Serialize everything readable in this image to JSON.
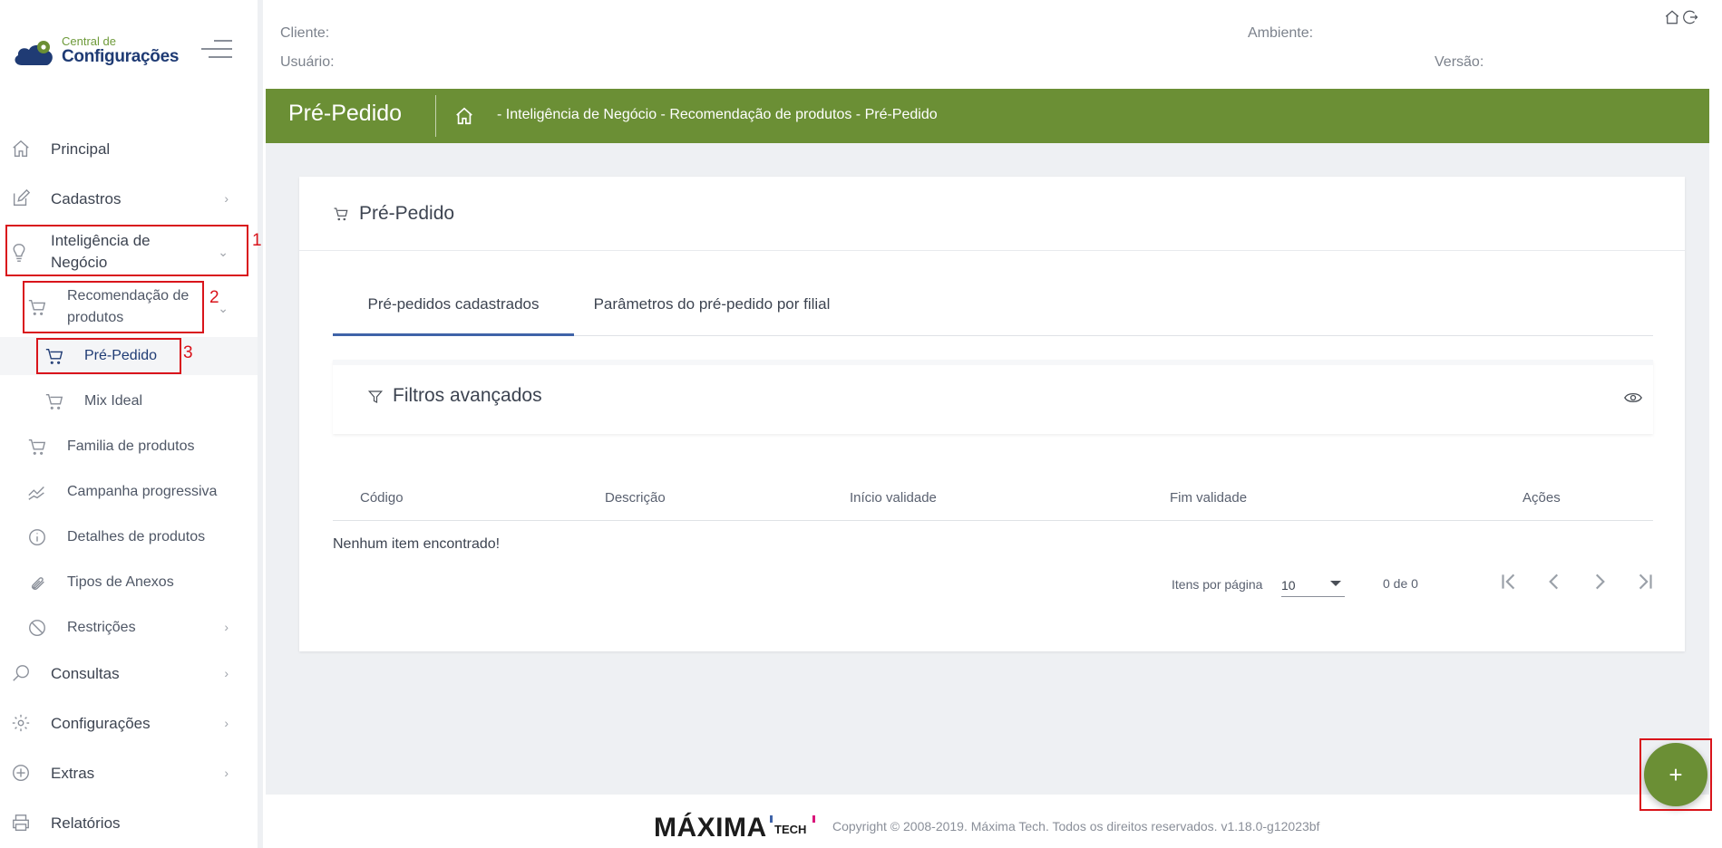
{
  "app": {
    "logo_line1": "Central de",
    "logo_line2": "Configurações"
  },
  "header": {
    "cliente_label": "Cliente:",
    "usuario_label": "Usuário:",
    "ambiente_label": "Ambiente:",
    "versao_label": "Versão:"
  },
  "sidebar": {
    "items": [
      {
        "label": "Principal",
        "icon": "home-icon"
      },
      {
        "label": "Cadastros",
        "icon": "edit-icon"
      },
      {
        "label": "Inteligência de Negócio",
        "icon": "lightbulb-icon"
      },
      {
        "label": "Recomendação de produtos",
        "icon": "cart-icon"
      },
      {
        "label": "Pré-Pedido",
        "icon": "cart-icon"
      },
      {
        "label": "Mix Ideal",
        "icon": "cart-icon"
      },
      {
        "label": "Familia de produtos",
        "icon": "cart-icon"
      },
      {
        "label": "Campanha progressiva",
        "icon": "trend-icon"
      },
      {
        "label": "Detalhes de produtos",
        "icon": "info-icon"
      },
      {
        "label": "Tipos de Anexos",
        "icon": "paperclip-icon"
      },
      {
        "label": "Restrições",
        "icon": "block-icon"
      },
      {
        "label": "Consultas",
        "icon": "search-icon"
      },
      {
        "label": "Configurações",
        "icon": "gear-icon"
      },
      {
        "label": "Extras",
        "icon": "plus-circle-icon"
      },
      {
        "label": "Relatórios",
        "icon": "printer-icon"
      }
    ],
    "markers": [
      "1",
      "2",
      "3"
    ]
  },
  "page": {
    "title": "Pré-Pedido",
    "breadcrumb": "- Inteligência de Negócio - Recomendação de produtos - Pré-Pedido"
  },
  "card": {
    "title": "Pré-Pedido",
    "tabs": [
      {
        "label": "Pré-pedidos cadastrados",
        "active": true
      },
      {
        "label": "Parâmetros do pré-pedido por filial",
        "active": false
      }
    ],
    "filters_title": "Filtros avançados",
    "table": {
      "columns": [
        "Código",
        "Descrição",
        "Início validade",
        "Fim validade",
        "Ações"
      ],
      "empty_message": "Nenhum item encontrado!"
    },
    "paginator": {
      "per_page_label": "Itens por página",
      "per_page_value": "10",
      "range_label": "0 de 0"
    }
  },
  "footer": {
    "brand": "MÁXIMA",
    "brand_suffix": "TECH",
    "copyright": "Copyright © 2008-2019. Máxima Tech. Todos os direitos reservados. v1.18.0-g12023bf"
  },
  "fab": {
    "label": "+"
  },
  "colors": {
    "primary_green": "#6b8f35",
    "brand_blue": "#1f3b74",
    "tab_active": "#3f63a8",
    "annotation_red": "#d9141b"
  }
}
